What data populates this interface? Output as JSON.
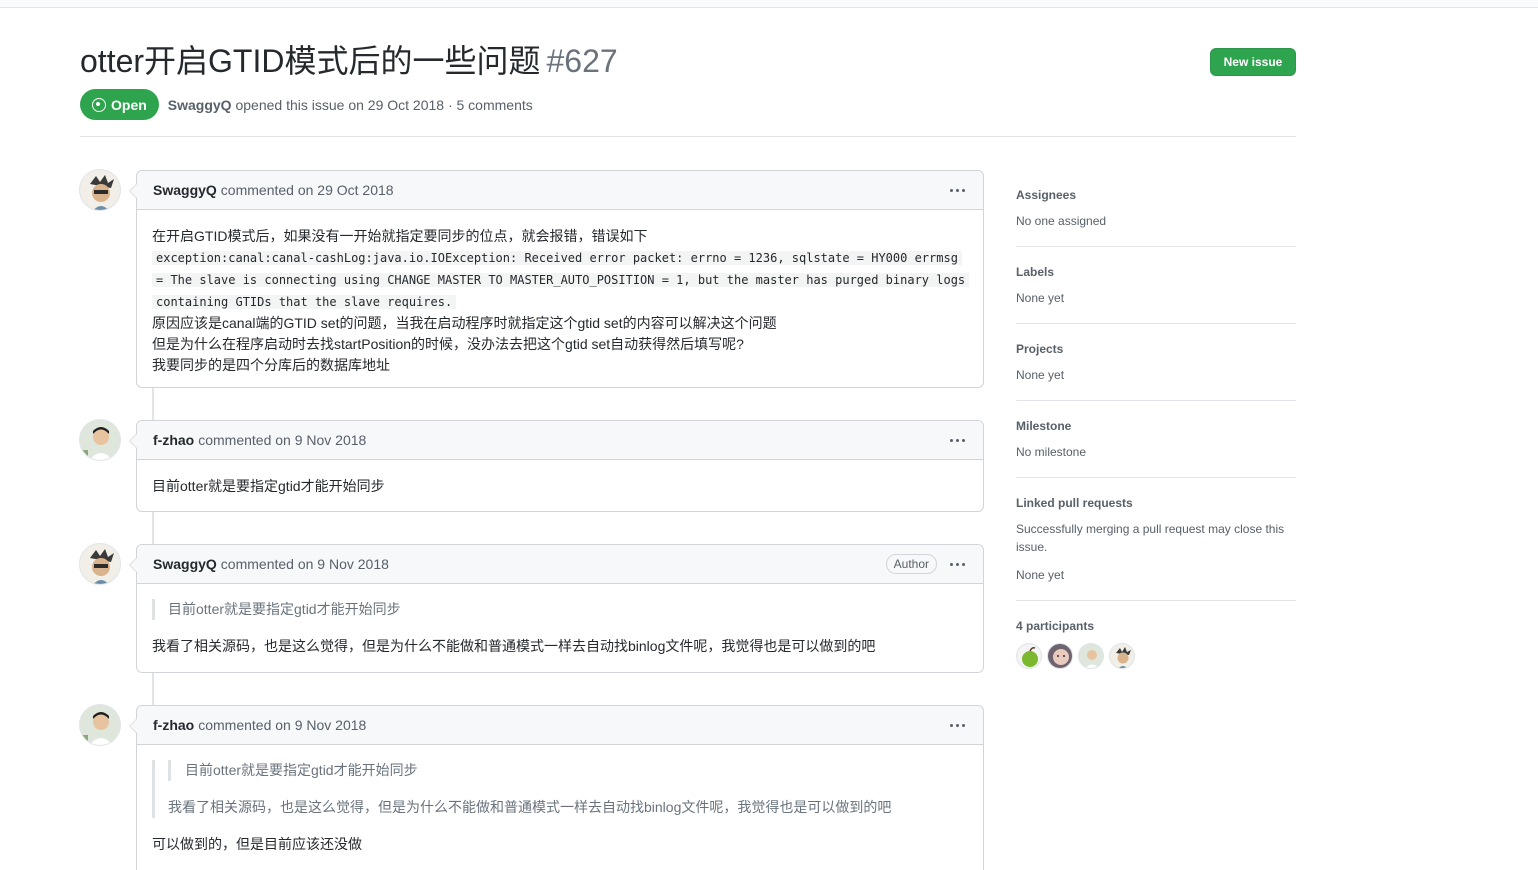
{
  "issue": {
    "title": "otter开启GTID模式后的一些问题",
    "number": "#627",
    "state": "Open",
    "author": "SwaggyQ",
    "opened_text": "opened this issue on 29 Oct 2018 · 5 comments",
    "new_issue_label": "New issue"
  },
  "comments": [
    {
      "author": "SwaggyQ",
      "meta": "commented on 29 Oct 2018",
      "badge": "",
      "lines": {
        "l1": "在开启GTID模式后，如果没有一开始就指定要同步的位点，就会报错，错误如下",
        "code1": "exception:canal:canal-cashLog:java.io.IOException: Received error packet: errno = 1236, sqlstate = HY000 errmsg",
        "code2": "= The slave is connecting using CHANGE MASTER TO MASTER_AUTO_POSITION = 1, but the master has purged binary logs",
        "code3": "containing GTIDs that the slave requires.",
        "l2": "原因应该是canal端的GTID set的问题，当我在启动程序时就指定这个gtid set的内容可以解决这个问题",
        "l3": "但是为什么在程序启动时去找startPosition的时候，没办法去把这个gtid set自动获得然后填写呢?",
        "l4": "我要同步的是四个分库后的数据库地址"
      }
    },
    {
      "author": "f-zhao",
      "meta": "commented on 9 Nov 2018",
      "badge": "",
      "text": "目前otter就是要指定gtid才能开始同步"
    },
    {
      "author": "SwaggyQ",
      "meta": "commented on 9 Nov 2018",
      "badge": "Author",
      "quote": "目前otter就是要指定gtid才能开始同步",
      "text": "我看了相关源码，也是这么觉得，但是为什么不能做和普通模式一样去自动找binlog文件呢，我觉得也是可以做到的吧"
    },
    {
      "author": "f-zhao",
      "meta": "commented on 9 Nov 2018",
      "badge": "",
      "quote_inner": "目前otter就是要指定gtid才能开始同步",
      "quote": "我看了相关源码，也是这么觉得，但是为什么不能做和普通模式一样去自动找binlog文件呢，我觉得也是可以做到的吧",
      "text": "可以做到的，但是目前应该还没做"
    }
  ],
  "sidebar": {
    "assignees": {
      "heading": "Assignees",
      "value": "No one assigned"
    },
    "labels": {
      "heading": "Labels",
      "value": "None yet"
    },
    "projects": {
      "heading": "Projects",
      "value": "None yet"
    },
    "milestone": {
      "heading": "Milestone",
      "value": "No milestone"
    },
    "linked_prs": {
      "heading": "Linked pull requests",
      "description": "Successfully merging a pull request may close this issue.",
      "value": "None yet"
    },
    "participants": {
      "heading": "4 participants"
    }
  },
  "colors": {
    "open_green": "#2ea44f",
    "border": "#d1d5da",
    "muted": "#586069"
  }
}
